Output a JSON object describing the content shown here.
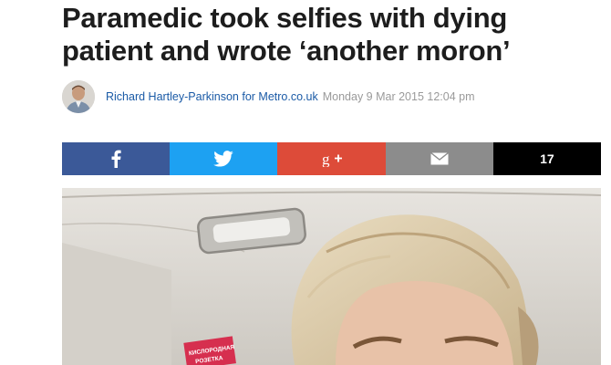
{
  "article": {
    "headline": "Paramedic took selfies with dying patient and wrote ‘another moron’",
    "author": "Richard Hartley-Parkinson for Metro.co.uk",
    "dateline": "Monday 9 Mar 2015 12:04 pm",
    "avatar_icon": "author-photo"
  },
  "share": {
    "buttons": [
      {
        "name": "facebook",
        "icon": "facebook-icon",
        "color": "#3b5998"
      },
      {
        "name": "twitter",
        "icon": "twitter-icon",
        "color": "#1da1f2"
      },
      {
        "name": "google-plus",
        "icon": "google-plus-icon",
        "color": "#dd4b39"
      },
      {
        "name": "email",
        "icon": "email-icon",
        "color": "#8c8c8c"
      }
    ],
    "count": "17",
    "count_bg": "#000000"
  },
  "photo": {
    "box_label_line1": "КИСЛОРОДНАЯ",
    "box_label_line2": "РОЗЕТКА"
  }
}
